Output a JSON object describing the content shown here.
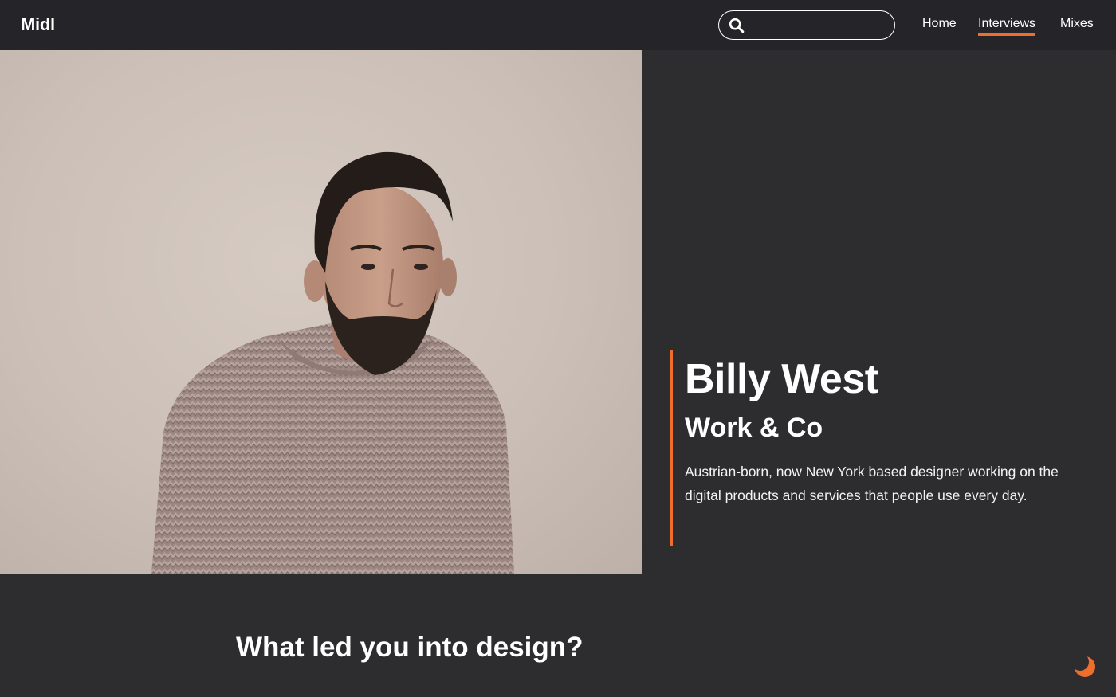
{
  "header": {
    "logo": "Midl",
    "search": {
      "value": "",
      "placeholder": ""
    },
    "nav": [
      {
        "label": "Home",
        "active": false
      },
      {
        "label": "Interviews",
        "active": true
      },
      {
        "label": "Mixes",
        "active": false
      }
    ]
  },
  "hero": {
    "photo_icon": "portrait-photo",
    "name": "Billy West",
    "company": "Work & Co",
    "bio": "Austrian-born, now New York based designer working on the digital products and services that people use every day."
  },
  "article": {
    "question": "What led you into design?"
  },
  "icons": {
    "search": "search-icon",
    "theme_toggle": "moon-icon"
  },
  "colors": {
    "accent": "#ee6f2d",
    "header_bg": "#252529",
    "page_bg": "#2d2d2f",
    "text": "#ffffff"
  }
}
